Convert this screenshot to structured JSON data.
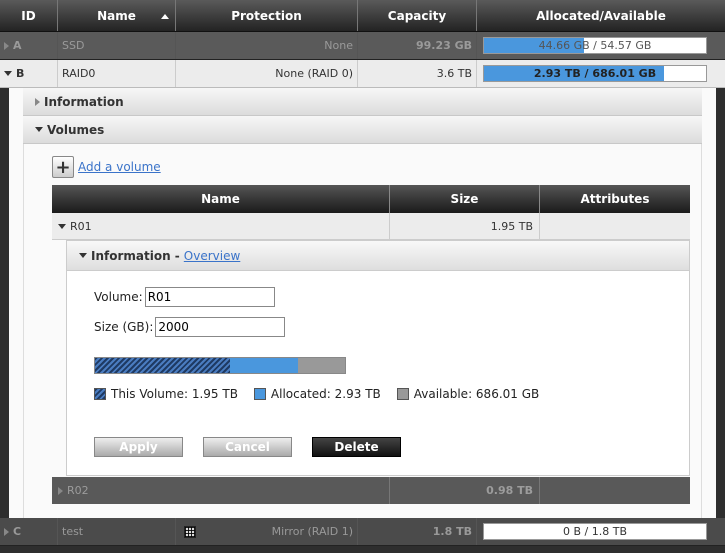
{
  "header": {
    "id": "ID",
    "name": "Name",
    "protection": "Protection",
    "capacity": "Capacity",
    "allocated": "Allocated/Available"
  },
  "rows": [
    {
      "id": "A",
      "name": "SSD",
      "protection": "None",
      "capacity": "99.23 GB",
      "allocated": "44.66 GB / 54.57 GB",
      "fill_fraction": 0.45
    },
    {
      "id": "B",
      "name": "RAID0",
      "protection": "None (RAID 0)",
      "capacity": "3.6 TB",
      "allocated": "2.93 TB / 686.01 GB",
      "fill_fraction": 0.81
    },
    {
      "id": "C",
      "name": "test",
      "protection": "Mirror (RAID 1)",
      "capacity": "1.8 TB",
      "allocated": "0 B / 1.8 TB",
      "fill_fraction": 0
    }
  ],
  "detail": {
    "information_label": "Information",
    "volumes_label": "Volumes",
    "add_volume": "Add a volume",
    "vol_table": {
      "name": "Name",
      "size": "Size",
      "attributes": "Attributes"
    },
    "volumes": [
      {
        "name": "R01",
        "size": "1.95 TB",
        "attributes": ""
      },
      {
        "name": "R02",
        "size": "0.98 TB",
        "attributes": ""
      }
    ],
    "vinfo": {
      "title": "Information -",
      "overview": "Overview",
      "volume_label": "Volume:",
      "volume_value": "R01",
      "size_label": "Size (GB):",
      "size_value": "2000",
      "usage": {
        "volume_fraction": 0.54,
        "allocated_fraction": 0.81
      },
      "legend": {
        "this_volume": "This Volume: 1.95 TB",
        "allocated": "Allocated: 2.93 TB",
        "available": "Available: 686.01 GB"
      },
      "apply": "Apply",
      "cancel": "Cancel",
      "delete": "Delete"
    }
  },
  "colors": {
    "accent": "#4a97dd",
    "header_bg": "#232323"
  }
}
